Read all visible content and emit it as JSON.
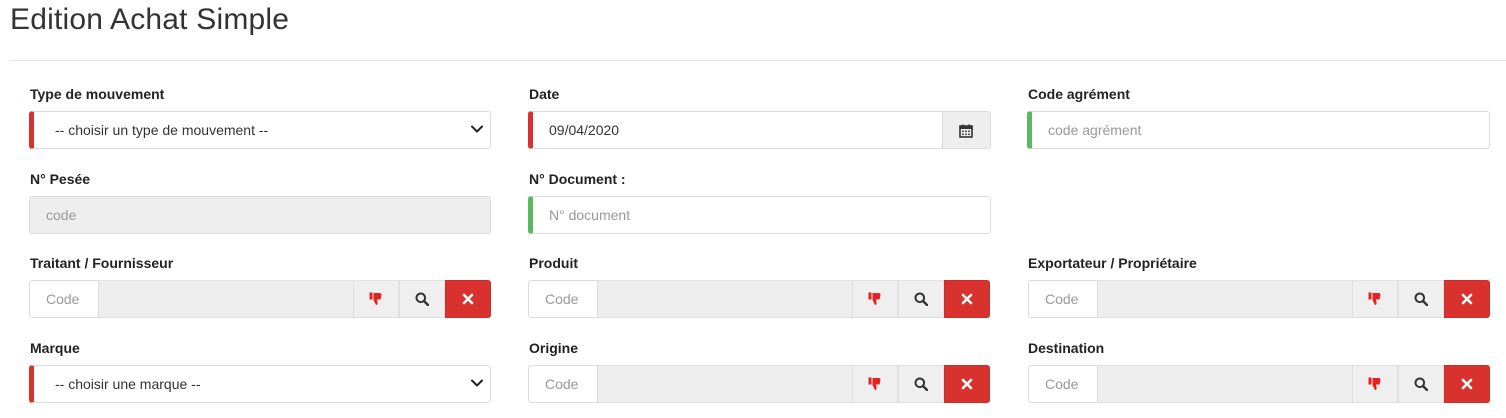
{
  "page": {
    "title": "Edition Achat Simple"
  },
  "colors": {
    "required_border": "#d9312d",
    "valid_border": "#5cb85c",
    "clear_button": "#d9312d",
    "disabled_background": "#eeeeee"
  },
  "form": {
    "type_mouvement": {
      "label": "Type de mouvement",
      "selected": "-- choisir un type de mouvement --"
    },
    "date": {
      "label": "Date",
      "value": "09/04/2020",
      "addon_icon": "calendar-icon"
    },
    "code_agrement": {
      "label": "Code agrément",
      "placeholder": "code agrément"
    },
    "num_pesee": {
      "label": "N° Pesée",
      "placeholder": "code"
    },
    "num_document": {
      "label": "N° Document :",
      "placeholder": "N° document"
    },
    "traitant": {
      "label": "Traitant / Fournisseur",
      "code_placeholder": "Code",
      "icons": [
        "thumbs-down-icon",
        "search-icon",
        "close-icon"
      ]
    },
    "produit": {
      "label": "Produit",
      "code_placeholder": "Code",
      "icons": [
        "thumbs-down-icon",
        "search-icon",
        "close-icon"
      ]
    },
    "exportateur": {
      "label": "Exportateur / Propriétaire",
      "code_placeholder": "Code",
      "icons": [
        "thumbs-down-icon",
        "search-icon",
        "close-icon"
      ]
    },
    "marque": {
      "label": "Marque",
      "selected": "-- choisir une marque --"
    },
    "origine": {
      "label": "Origine",
      "code_placeholder": "Code",
      "icons": [
        "thumbs-down-icon",
        "search-icon",
        "close-icon"
      ]
    },
    "destination": {
      "label": "Destination",
      "code_placeholder": "Code",
      "icons": [
        "thumbs-down-icon",
        "search-icon",
        "close-icon"
      ]
    }
  }
}
